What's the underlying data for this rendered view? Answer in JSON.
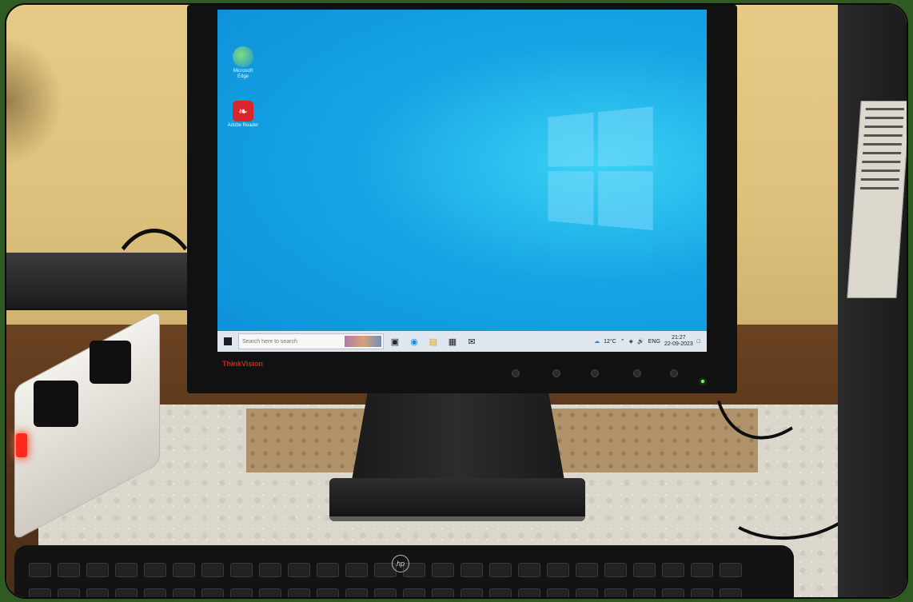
{
  "desktop": {
    "icons": [
      {
        "name": "microsoft-edge-icon",
        "label": "Microsoft Edge"
      },
      {
        "name": "adobe-reader-icon",
        "label": "Adobe Reader"
      }
    ]
  },
  "taskbar": {
    "search_placeholder": "Search here to search",
    "pinned": [
      "task-view-icon",
      "edge-icon",
      "file-explorer-icon",
      "store-icon",
      "mail-icon"
    ],
    "weather": "12°C",
    "language": "ENG",
    "time": "21:27",
    "date": "22-09-2023"
  },
  "monitor": {
    "brand": "ThinkVision"
  },
  "keyboard": {
    "brand_logo": "hp"
  },
  "colors": {
    "screen": "#15a5e4",
    "taskbar": "#dfe6ed",
    "wall": "#e2c680",
    "power_led": "#6dff43",
    "strip_switch": "#ff2b1a"
  }
}
